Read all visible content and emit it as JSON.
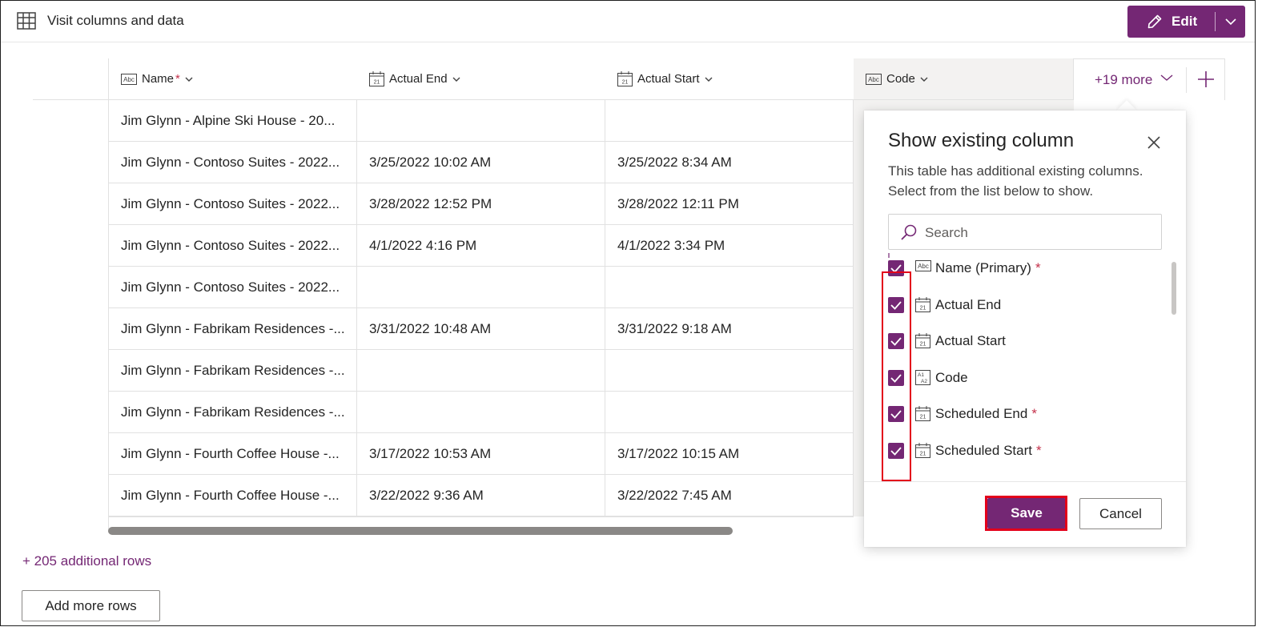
{
  "header": {
    "title": "Visit columns and data",
    "edit_label": "Edit",
    "accent_color": "#742774"
  },
  "grid": {
    "columns": [
      {
        "label": "Name",
        "required_marker": "*",
        "type_icon": "text-icon"
      },
      {
        "label": "Actual End",
        "type_icon": "calendar-icon"
      },
      {
        "label": "Actual Start",
        "type_icon": "calendar-icon"
      },
      {
        "label": "Code",
        "type_icon": "text-icon"
      }
    ],
    "more_columns_label": "+19 more",
    "rows": [
      {
        "name": "Jim Glynn - Alpine Ski House - 20...",
        "actual_end": "",
        "actual_start": ""
      },
      {
        "name": "Jim Glynn - Contoso Suites - 2022...",
        "actual_end": "3/25/2022 10:02 AM",
        "actual_start": "3/25/2022 8:34 AM"
      },
      {
        "name": "Jim Glynn - Contoso Suites - 2022...",
        "actual_end": "3/28/2022 12:52 PM",
        "actual_start": "3/28/2022 12:11 PM"
      },
      {
        "name": "Jim Glynn - Contoso Suites - 2022...",
        "actual_end": "4/1/2022 4:16 PM",
        "actual_start": "4/1/2022 3:34 PM"
      },
      {
        "name": "Jim Glynn - Contoso Suites - 2022...",
        "actual_end": "",
        "actual_start": ""
      },
      {
        "name": "Jim Glynn - Fabrikam Residences -...",
        "actual_end": "3/31/2022 10:48 AM",
        "actual_start": "3/31/2022 9:18 AM"
      },
      {
        "name": "Jim Glynn - Fabrikam Residences -...",
        "actual_end": "",
        "actual_start": ""
      },
      {
        "name": "Jim Glynn - Fabrikam Residences -...",
        "actual_end": "",
        "actual_start": ""
      },
      {
        "name": "Jim Glynn - Fourth Coffee House -...",
        "actual_end": "3/17/2022 10:53 AM",
        "actual_start": "3/17/2022 10:15 AM"
      },
      {
        "name": "Jim Glynn - Fourth Coffee House -...",
        "actual_end": "3/22/2022 9:36 AM",
        "actual_start": "3/22/2022 7:45 AM"
      }
    ],
    "additional_rows_label": "+ 205 additional rows",
    "add_more_rows_label": "Add more rows"
  },
  "popup": {
    "title": "Show existing column",
    "description": "This table has additional existing columns. Select from the list below to show.",
    "search_placeholder": "Search",
    "items": [
      {
        "label": "Name (Primary)",
        "required_marker": "*",
        "checked": true,
        "type_icon": "text-icon"
      },
      {
        "label": "Actual End",
        "checked": true,
        "type_icon": "calendar-icon"
      },
      {
        "label": "Actual Start",
        "checked": true,
        "type_icon": "calendar-icon"
      },
      {
        "label": "Code",
        "checked": true,
        "type_icon": "autonumber-icon"
      },
      {
        "label": "Scheduled End",
        "required_marker": "*",
        "checked": true,
        "type_icon": "calendar-icon"
      },
      {
        "label": "Scheduled Start",
        "required_marker": "*",
        "checked": true,
        "type_icon": "calendar-icon"
      }
    ],
    "save_label": "Save",
    "cancel_label": "Cancel"
  }
}
